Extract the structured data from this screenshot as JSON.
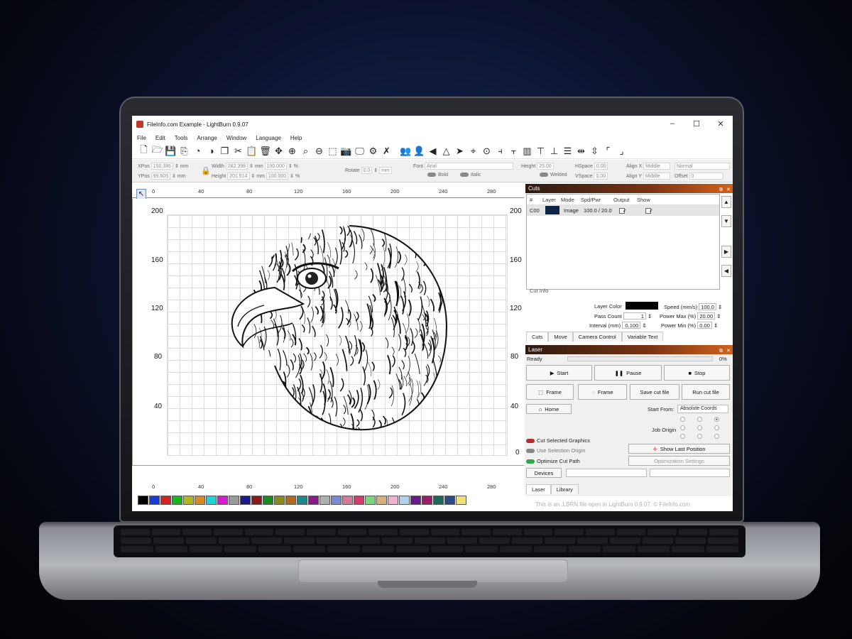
{
  "window": {
    "title": "FileInfo.com Example - LightBurn 0.9.07",
    "controls": [
      "–",
      "☐",
      "✕"
    ]
  },
  "menu": [
    "File",
    "Edit",
    "Tools",
    "Arrange",
    "Window",
    "Language",
    "Help"
  ],
  "toolbar_icons": [
    "new-file",
    "open",
    "save",
    "import",
    "trace",
    "offset",
    "copy",
    "cut",
    "paste",
    "delete",
    "move",
    "zoom-in",
    "zoom-fit",
    "zoom-out",
    "select",
    "camera",
    "monitor",
    "settings",
    "tools",
    "group",
    "user",
    "mirror",
    "flip",
    "send",
    "target",
    "align1",
    "align2",
    "align3",
    "align4",
    "align5",
    "align6",
    "align7",
    "align8",
    "align9"
  ],
  "props": {
    "xpos_label": "XPos",
    "xpos": "150.386",
    "ypos_label": "YPos",
    "ypos": "99.605",
    "unit": "mm",
    "width_label": "Width",
    "width": "282.398",
    "height_label": "Height",
    "height": "201.514",
    "scale_w": "100.000",
    "scale_h": "100.000",
    "pct": "%",
    "rotate_label": "Rotate",
    "rotate": "0.0",
    "rot_unit": "mm",
    "font_label": "Font",
    "font": "Arial",
    "fheight_label": "Height",
    "fheight": "25.00",
    "hspace_label": "HSpace",
    "hspace": "0.00",
    "vspace_label": "VSpace",
    "vspace": "0.00",
    "bold": "Bold",
    "italic": "Italic",
    "welded": "Welded",
    "alignx_label": "Align X",
    "alignx": "Middle",
    "aligny_label": "Align Y",
    "aligny": "Middle",
    "normal": "Normal",
    "offset_label": "Offset",
    "offset": "0"
  },
  "ruler": {
    "top": [
      "0",
      "40",
      "80",
      "120",
      "160",
      "200",
      "240",
      "280"
    ],
    "bottom": [
      "0",
      "40",
      "80",
      "120",
      "160",
      "200",
      "240",
      "280"
    ]
  },
  "axis": {
    "left": [
      "200",
      "160",
      "120",
      "80",
      "40"
    ],
    "right": [
      "200",
      "160",
      "120",
      "80",
      "40",
      "0"
    ]
  },
  "palette": [
    "#000000",
    "#1a3cd6",
    "#d81f1f",
    "#19b51f",
    "#b2b81a",
    "#d88a1c",
    "#1ad6d6",
    "#d61ad6",
    "#9a9a9a",
    "#1a1a8a",
    "#8a1a1a",
    "#1a8a1a",
    "#8a8a1a",
    "#b06a1a",
    "#1a8a8a",
    "#8a1a8a",
    "#b0b0b0",
    "#7a8ad6",
    "#d67a9a",
    "#d63a6a",
    "#7ad67a",
    "#d6b07a",
    "#f0b0d0",
    "#b0d0f0",
    "#6a1a8a",
    "#a01a6a",
    "#1a6a5a",
    "#2a4a8a",
    "#f0e070"
  ],
  "status_text": "This is an .LBRN file open in LightBurn 0.9.07. © FileInfo.com",
  "cuts_panel": {
    "title": "Cuts",
    "headers": [
      "#",
      "Layer",
      "Mode",
      "Spd/Pwr",
      "Output",
      "Show"
    ],
    "row": {
      "num": "C00",
      "layer_color": "#0d2545",
      "mode": "Image",
      "spd": "100.0 / 20.0",
      "output": "✓",
      "show": "✓"
    },
    "cut_info_label": "Cut Info",
    "layer_color_label": "Layer Color",
    "speed_label": "Speed (mm/s)",
    "speed": "100.0",
    "pass_label": "Pass Count",
    "pass": "1",
    "pmax_label": "Power Max (%)",
    "pmax": "20.00",
    "interval_label": "Interval (mm)",
    "interval": "0.100",
    "pmin_label": "Power Min (%)",
    "pmin": "0.00",
    "tabs": [
      "Cuts",
      "Move",
      "Camera Control",
      "Variable Text"
    ]
  },
  "laser_panel": {
    "title": "Laser",
    "status": "Ready",
    "progress": "0%",
    "progress_value": 0,
    "start": "Start",
    "pause": "Pause",
    "stop": "Stop",
    "frame1": "Frame",
    "frame2": "Frame",
    "save_cut": "Save cut file",
    "run_cut": "Run cut file",
    "home": "Home",
    "start_from_label": "Start From:",
    "start_from": "Absolute Coords",
    "job_origin": "Job Origin",
    "cut_selected": "Cut Selected Graphics",
    "use_sel_origin": "Use Selection Origin",
    "optimize": "Optimize Cut Path",
    "show_last": "Show Last Position",
    "opt_settings": "Optimization Settings",
    "devices": "Devices",
    "tabs": [
      "Laser",
      "Library"
    ]
  }
}
